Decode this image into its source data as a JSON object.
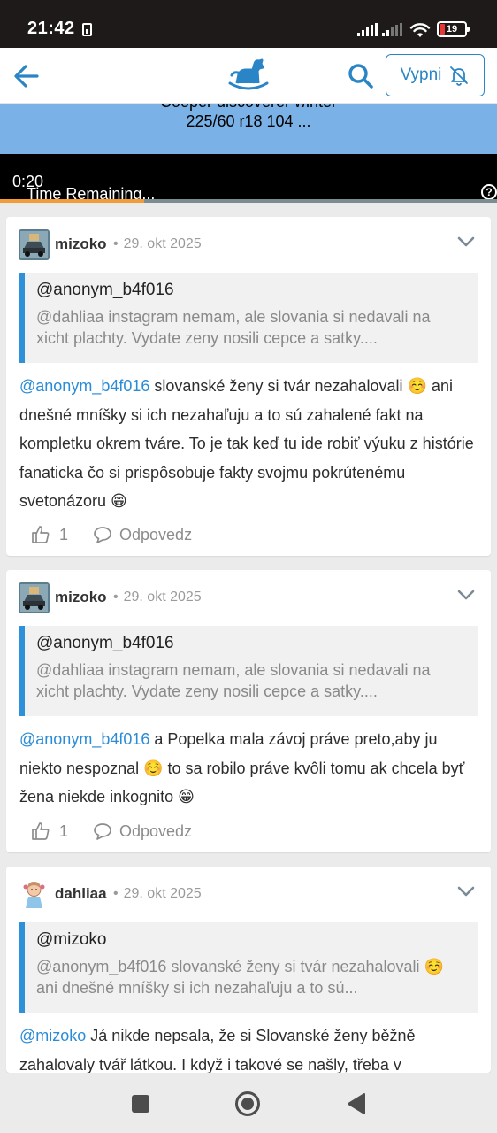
{
  "status_bar": {
    "time": "21:42",
    "battery": "19",
    "sim_icon": "sim-card-icon",
    "wifi_icon": "wifi-icon"
  },
  "header": {
    "back_icon": "arrow-left-icon",
    "logo_icon": "rocking-horse-logo",
    "search_icon": "search-icon",
    "vypni_label": "Vypni",
    "vypni_icon": "bell-off-icon",
    "accent_color": "#2a85c7"
  },
  "ad": {
    "line1": "Cooper discoverer winter",
    "line2": "225/60 r18 104 ...",
    "video_time": "0:20",
    "remaining": "Time Remaining...",
    "help_label": "?",
    "progress": 0.29
  },
  "comments": [
    {
      "author": "mizoko",
      "date": "29. okt 2025",
      "avatar": "car-photo-avatar",
      "quote_author": "@anonym_b4f016",
      "quote_text": "@dahliaa instagram nemam, ale slovania si nedavali na xicht plachty. Vydate zeny nosili cepce a satky....",
      "mention": "@anonym_b4f016",
      "text": " slovanské ženy si tvár nezahalovali ☺️ ani dnešné mníšky si ich nezahaľuju a to sú zahalené fakt na kompletku okrem tváre. To je tak keď tu ide robiť výuku z histórie fanaticka čo si prispôsobuje fakty svojmu pokrútenému svetonázoru 😁",
      "likes": "1",
      "reply_label": "Odpovedz"
    },
    {
      "author": "mizoko",
      "date": "29. okt 2025",
      "avatar": "car-photo-avatar",
      "quote_author": "@anonym_b4f016",
      "quote_text": "@dahliaa instagram nemam, ale slovania si nedavali na xicht plachty. Vydate zeny nosili cepce a satky....",
      "mention": "@anonym_b4f016",
      "text": " a Popelka mala závoj práve preto,aby ju niekto nespoznal ☺️ to sa robilo práve kvôli tomu ak chcela byť žena niekde inkognito 😁",
      "likes": "1",
      "reply_label": "Odpovedz"
    },
    {
      "author": "dahliaa",
      "date": "29. okt 2025",
      "avatar": "girl-cartoon-avatar",
      "quote_author": "@mizoko",
      "quote_text": "@anonym_b4f016 slovanské ženy si tvár nezahalovali ☺️ ani dnešné mníšky si ich nezahaľuju a to sú...",
      "mention": "@mizoko",
      "text": " Já nikde nepsala, že si Slovanské ženy běžně zahalovaly tvář látkou. I když i takové se našly, třeba v"
    }
  ],
  "nav_bar": {
    "recents_icon": "square-recents-icon",
    "home_icon": "circle-home-icon",
    "back_icon": "triangle-back-icon"
  }
}
